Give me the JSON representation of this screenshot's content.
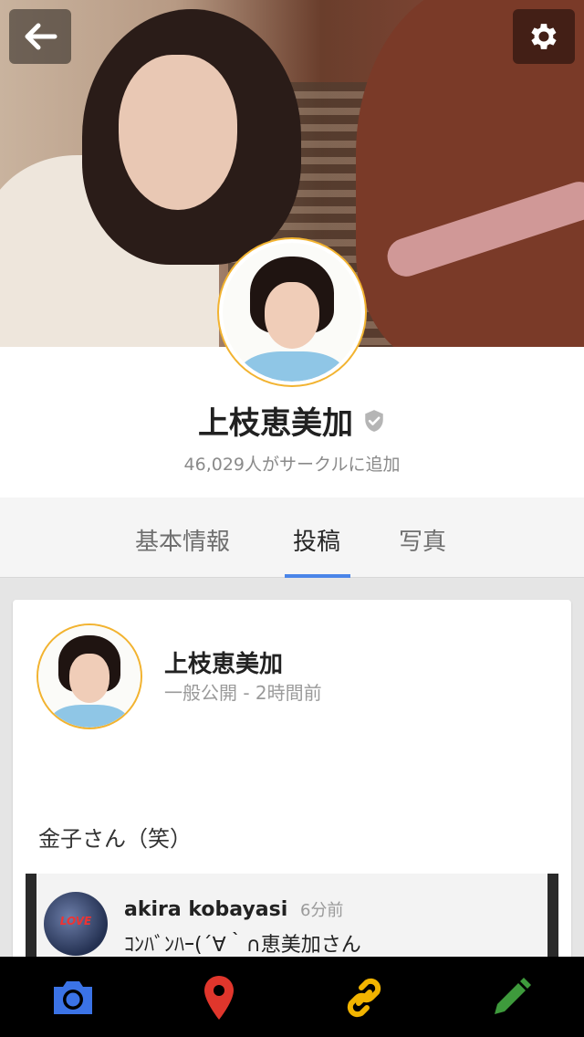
{
  "profile": {
    "name": "上枝恵美加",
    "followers": "46,029人がサークルに追加"
  },
  "tabs": [
    {
      "label": "基本情報",
      "active": false
    },
    {
      "label": "投稿",
      "active": true
    },
    {
      "label": "写真",
      "active": false
    }
  ],
  "post": {
    "author": "上枝恵美加",
    "meta": "一般公開 - 2時間前",
    "text": "金子さん（笑）",
    "comment": {
      "author": "akira kobayasi",
      "time": "6分前",
      "text": "ｺﾝﾊﾞﾝﾊｰ(´∀｀∩恵美加さん"
    }
  },
  "bottom_bar": {
    "icons": [
      "camera-icon",
      "location-icon",
      "link-icon",
      "pencil-icon"
    ],
    "colors": {
      "camera": "#3b73e6",
      "location": "#e0362c",
      "link": "#f2b400",
      "pencil": "#3e9a3c"
    }
  },
  "colors": {
    "accent": "#4a85e8",
    "avatar_ring": "#f2b330"
  }
}
